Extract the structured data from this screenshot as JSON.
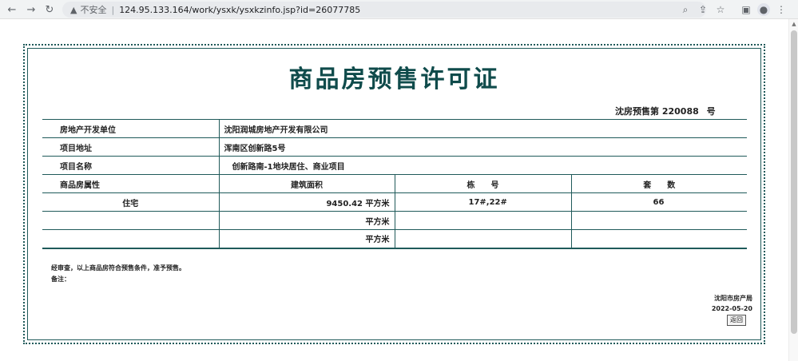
{
  "browser": {
    "back_icon": "arrow-left-icon",
    "forward_icon": "arrow-right-icon",
    "reload_icon": "reload-icon",
    "warning_icon": "warning-triangle-icon",
    "insecure_label": "不安全",
    "separator": "|",
    "url": "124.95.133.164/work/ysxk/ysxkzinfo.jsp?id=26077785",
    "right_icons": [
      "zoom-icon",
      "share-icon",
      "star-icon",
      "sidebar-icon",
      "profile-icon",
      "menu-icon"
    ]
  },
  "certificate": {
    "title": "商品房预售许可证",
    "number_prefix": "沈房预售第",
    "number": "220088",
    "number_suffix": "号",
    "rows": {
      "developer_label": "房地产开发单位",
      "developer_value": "沈阳润城房地产开发有限公司",
      "address_label": "项目地址",
      "address_value": "浑南区创新路5号",
      "project_label": "项目名称",
      "project_value": "创新路南-1地块居住、商业项目"
    },
    "headers": {
      "attribute": "商品房属性",
      "area": "建筑面积",
      "building": "栋　　号",
      "units": "套　　数"
    },
    "items": [
      {
        "attribute": "住宅",
        "area": "9450.42 平方米",
        "building": "17#,22#",
        "units": "66"
      },
      {
        "attribute": "",
        "area": "平方米",
        "building": "",
        "units": ""
      },
      {
        "attribute": "",
        "area": "平方米",
        "building": "",
        "units": ""
      }
    ],
    "approval_text": "经审查，以上商品房符合预售条件，准予预售。",
    "remark_label": "备注：",
    "issuer": "沈阳市房产局",
    "date": "2022-05-20",
    "back_button": "返回"
  }
}
